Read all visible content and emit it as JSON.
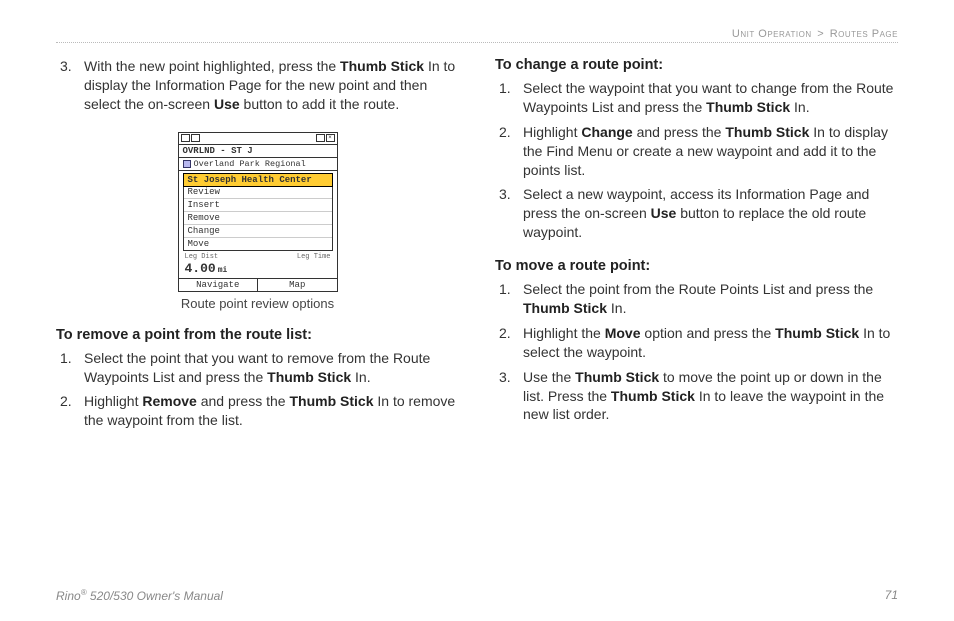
{
  "breadcrumb": {
    "section": "Unit Operation",
    "sep": ">",
    "page": "Routes Page"
  },
  "left": {
    "intro_item": "With the new point highlighted, press the <b>Thumb Stick</b> In to display the Information Page for the new point and then select the on-screen <b>Use</b> button to add it the route.",
    "caption": "Route point review options",
    "h_remove": "To remove a point from the route list:",
    "remove_items": [
      "Select the point that you want to remove from the Route Waypoints List and press the <b>Thumb Stick</b> In.",
      "Highlight <b>Remove</b> and press the <b>Thumb Stick</b> In to remove the waypoint from the list."
    ]
  },
  "right": {
    "h_change": "To change a route point:",
    "change_items": [
      "Select the waypoint that you want to change from the Route Waypoints List and press the <b>Thumb Stick</b> In.",
      "Highlight <b>Change</b> and press the <b>Thumb Stick</b> In to display the Find Menu or create a new waypoint and add it to the points list.",
      "Select a new waypoint, access its Information Page and press the on-screen <b>Use</b> button to replace the old route waypoint."
    ],
    "h_move": "To move a route point:",
    "move_items": [
      "Select the point from the Route Points List and press the <b>Thumb Stick</b> In.",
      "Highlight the <b>Move</b> option and press the <b>Thumb Stick</b> In to select the waypoint.",
      "Use the <b>Thumb Stick</b> to move the point up or down in the list. Press the <b>Thumb Stick</b> In to leave the waypoint in the new list order."
    ]
  },
  "device": {
    "title": "OVRLND - ST J",
    "subtitle": "Overland Park Regional",
    "highlight": "St Joseph Health Center",
    "menu": [
      "Review",
      "Insert",
      "Remove",
      "Change",
      "Move"
    ],
    "info_l": "Leg Dist",
    "info_r": "Leg Time",
    "dist": "4.00",
    "unit": "mi",
    "btn_l": "Navigate",
    "btn_r": "Map"
  },
  "footer": {
    "left_a": "Rino",
    "left_sup": "®",
    "left_b": " 520/530 Owner's Manual",
    "page": "71"
  }
}
